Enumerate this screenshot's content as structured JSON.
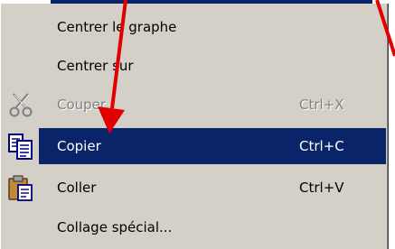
{
  "menu": {
    "items": [
      {
        "label": "Centrer le graphe",
        "shortcut": "",
        "icon": "",
        "state": "normal"
      },
      {
        "label": "Centrer sur",
        "shortcut": "",
        "icon": "",
        "state": "normal"
      },
      {
        "label": "Couper",
        "shortcut": "Ctrl+X",
        "icon": "scissors-icon",
        "state": "disabled"
      },
      {
        "label": "Copier",
        "shortcut": "Ctrl+C",
        "icon": "copy-icon",
        "state": "selected"
      },
      {
        "label": "Coller",
        "shortcut": "Ctrl+V",
        "icon": "paste-icon",
        "state": "normal"
      },
      {
        "label": "Collage spécial...",
        "shortcut": "",
        "icon": "",
        "state": "normal"
      }
    ]
  },
  "colors": {
    "menu_background": "#d4d0c8",
    "selection": "#0a246a",
    "disabled_text": "#808080",
    "annotation_arrow": "#e00000"
  }
}
